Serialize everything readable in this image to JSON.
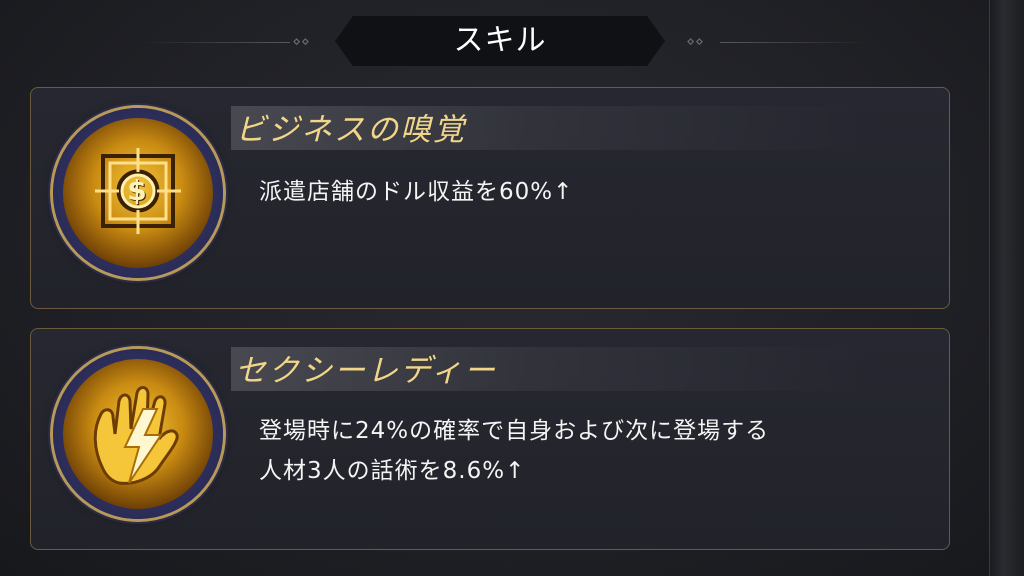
{
  "header": {
    "title": "スキル"
  },
  "skills": [
    {
      "name": "ビジネスの嗅覚",
      "description_lines": [
        "派遣店舗のドル収益を60%↑"
      ],
      "icon": "dollar-safe-icon"
    },
    {
      "name": "セクシーレディー",
      "description_lines": [
        "登場時に24%の確率で自身および次に登場する",
        "人材3人の話術を8.6%↑"
      ],
      "icon": "lightning-hand-icon"
    }
  ],
  "colors": {
    "skill_name": "#f1d68a",
    "card_border": "#6b5b3c",
    "icon_gold": "#f3c33a"
  }
}
